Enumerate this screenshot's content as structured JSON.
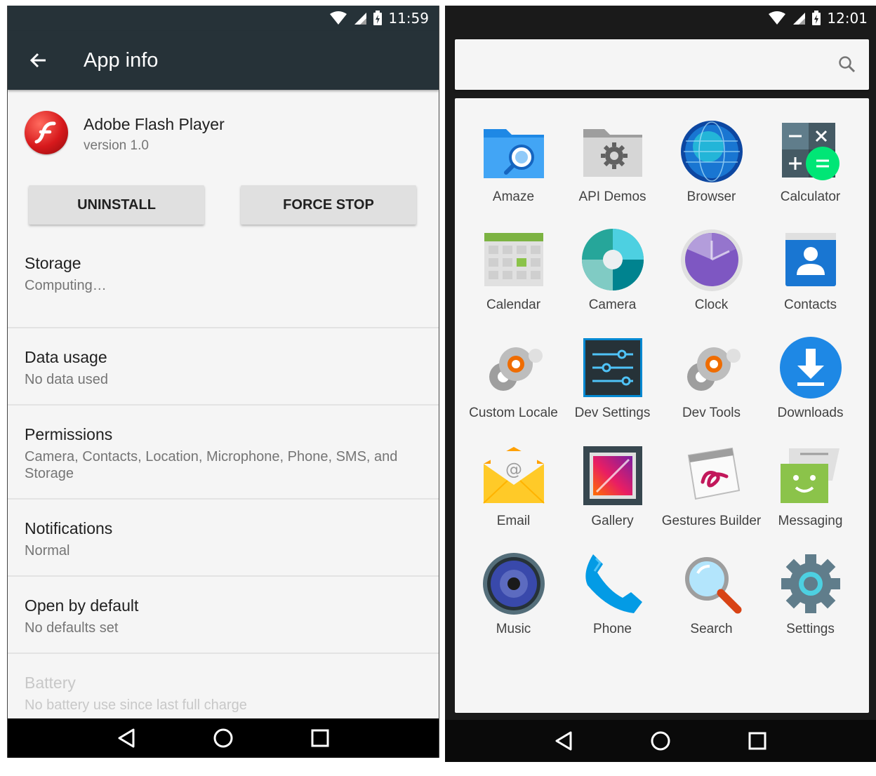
{
  "left_screen": {
    "status_bar": {
      "time": "11:59"
    },
    "app_bar": {
      "title": "App info"
    },
    "app": {
      "name": "Adobe Flash Player",
      "version": "version 1.0"
    },
    "buttons": {
      "uninstall": "UNINSTALL",
      "force_stop": "FORCE STOP"
    },
    "prefs": [
      {
        "title": "Storage",
        "subtitle": "Computing…"
      },
      {
        "title": "Data usage",
        "subtitle": "No data used"
      },
      {
        "title": "Permissions",
        "subtitle": "Camera, Contacts, Location, Microphone, Phone, SMS, and Storage"
      },
      {
        "title": "Notifications",
        "subtitle": "Normal"
      },
      {
        "title": "Open by default",
        "subtitle": "No defaults set"
      },
      {
        "title": "Battery",
        "subtitle": "No battery use since last full charge",
        "disabled": true
      }
    ]
  },
  "right_screen": {
    "status_bar": {
      "time": "12:01"
    },
    "search": {
      "icon": "search-icon"
    },
    "apps": [
      {
        "label": "Amaze",
        "icon": "amaze-icon"
      },
      {
        "label": "API Demos",
        "icon": "api-demos-icon"
      },
      {
        "label": "Browser",
        "icon": "browser-icon"
      },
      {
        "label": "Calculator",
        "icon": "calculator-icon"
      },
      {
        "label": "Calendar",
        "icon": "calendar-icon"
      },
      {
        "label": "Camera",
        "icon": "camera-icon"
      },
      {
        "label": "Clock",
        "icon": "clock-icon"
      },
      {
        "label": "Contacts",
        "icon": "contacts-icon"
      },
      {
        "label": "Custom Locale",
        "icon": "custom-locale-icon"
      },
      {
        "label": "Dev Settings",
        "icon": "dev-settings-icon"
      },
      {
        "label": "Dev Tools",
        "icon": "dev-tools-icon"
      },
      {
        "label": "Downloads",
        "icon": "downloads-icon"
      },
      {
        "label": "Email",
        "icon": "email-icon"
      },
      {
        "label": "Gallery",
        "icon": "gallery-icon"
      },
      {
        "label": "Gestures Builder",
        "icon": "gestures-builder-icon"
      },
      {
        "label": "Messaging",
        "icon": "messaging-icon"
      },
      {
        "label": "Music",
        "icon": "music-icon"
      },
      {
        "label": "Phone",
        "icon": "phone-icon"
      },
      {
        "label": "Search",
        "icon": "search-app-icon"
      },
      {
        "label": "Settings",
        "icon": "settings-icon"
      }
    ]
  },
  "colors": {
    "appbar": "#263238",
    "background": "#f5f5f5",
    "nav": "#000000"
  }
}
